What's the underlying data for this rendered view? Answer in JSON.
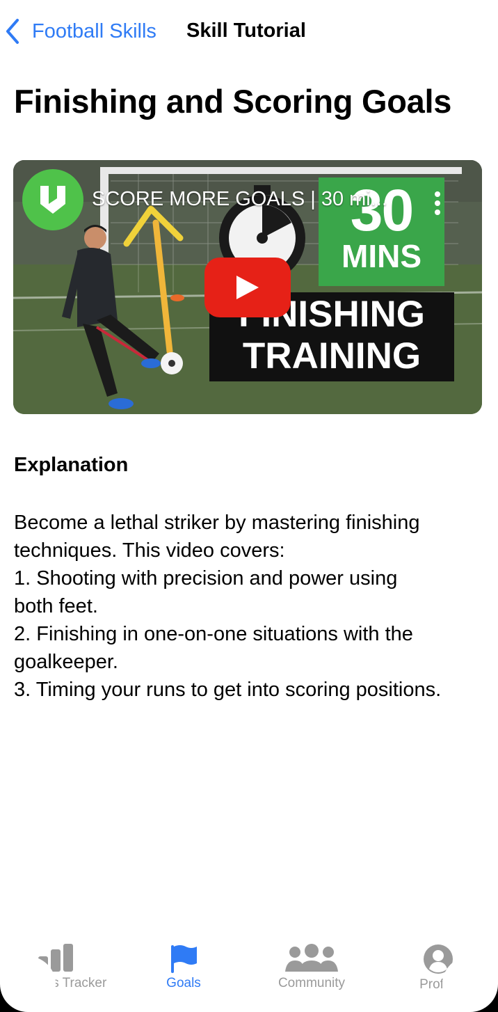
{
  "nav": {
    "back_label": "Football Skills",
    "title": "Skill Tutorial"
  },
  "page": {
    "title": "Finishing and Scoring Goals"
  },
  "video": {
    "title": "SCORE MORE GOALS | 30 mi...",
    "thumbnail_big": "30",
    "thumbnail_small": "MINS",
    "thumbnail_line1": "FINISHING",
    "thumbnail_line2": "TRAINING"
  },
  "explanation": {
    "heading": "Explanation",
    "lines": [
      "Become a lethal striker by mastering finishing",
      "techniques. This video covers:",
      "1. Shooting with precision and power using",
      "both feet.",
      "2. Finishing in one-on-one situations with the",
      "goalkeeper.",
      "3. Timing your runs to get into scoring positions."
    ]
  },
  "tabs": [
    {
      "label": "Progress Tracker",
      "icon": "bar-chart-icon",
      "active": false
    },
    {
      "label": "Goals",
      "icon": "flag-icon",
      "active": true
    },
    {
      "label": "Community",
      "icon": "people-icon",
      "active": false
    },
    {
      "label": "Profile",
      "icon": "person-circle-icon",
      "active": false
    }
  ],
  "colors": {
    "accent": "#2f7bf5",
    "inactive_tab": "#9a9a9a",
    "play_button": "#e62117",
    "channel_logo": "#4fc24a"
  }
}
